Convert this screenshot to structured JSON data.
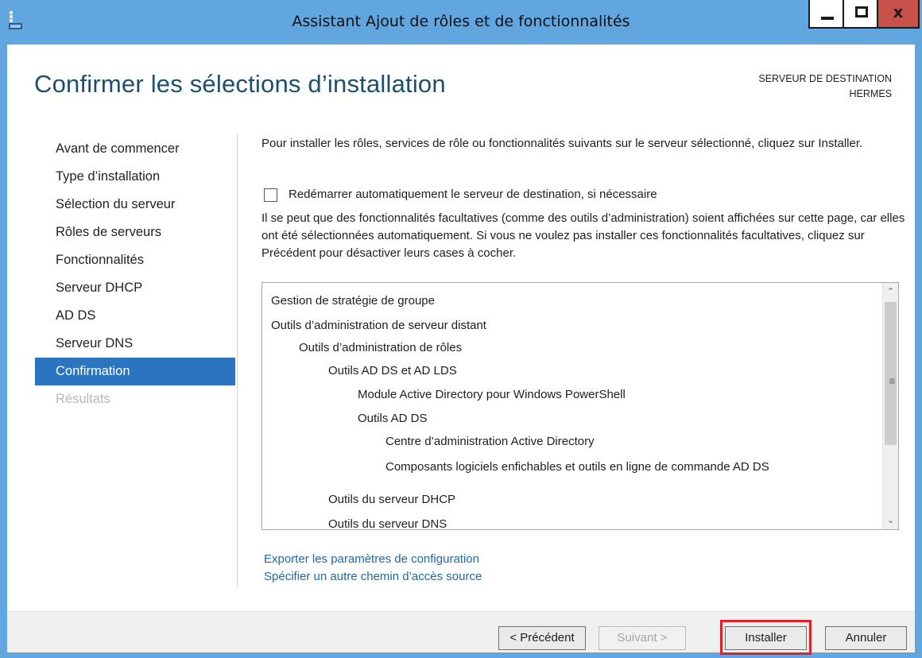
{
  "window": {
    "title": "Assistant Ajout de rôles et de fonctionnalités",
    "minimize_icon": "minimize-icon",
    "maximize_icon": "maximize-icon",
    "close_glyph": "x",
    "accent_color": "#62a6e0"
  },
  "header": {
    "page_title": "Confirmer les sélections d’installation",
    "dest_label": "SERVEUR DE DESTINATION",
    "dest_server": "HERMES"
  },
  "sidebar": {
    "items": [
      {
        "label": "Avant de commencer",
        "state": "normal"
      },
      {
        "label": "Type d’installation",
        "state": "normal"
      },
      {
        "label": "Sélection du serveur",
        "state": "normal"
      },
      {
        "label": "Rôles de serveurs",
        "state": "normal"
      },
      {
        "label": "Fonctionnalités",
        "state": "normal"
      },
      {
        "label": "Serveur DHCP",
        "state": "normal"
      },
      {
        "label": "AD DS",
        "state": "normal"
      },
      {
        "label": "Serveur DNS",
        "state": "normal"
      },
      {
        "label": "Confirmation",
        "state": "active"
      },
      {
        "label": "Résultats",
        "state": "disabled"
      }
    ],
    "active_color": "#2b74bf"
  },
  "main": {
    "intro": "Pour installer les rôles, services de rôle ou fonctionnalités suivants sur le serveur sélectionné, cliquez sur Installer.",
    "restart_checkbox": {
      "label": "Redémarrer automatiquement le serveur de destination, si nécessaire",
      "checked": false
    },
    "note": "Il se peut que des fonctionnalités facultatives (comme des outils d’administration) soient affichées sur cette page, car elles ont été sélectionnées automatiquement. Si vous ne voulez pas installer ces fonctionnalités facultatives, cliquez sur Précédent pour désactiver leurs cases à cocher.",
    "features": [
      {
        "label": "Gestion de stratégie de groupe",
        "level": 0
      },
      {
        "label": "Outils d’administration de serveur distant",
        "level": 0
      },
      {
        "label": "Outils d’administration de rôles",
        "level": 1
      },
      {
        "label": "Outils AD DS et AD LDS",
        "level": 2
      },
      {
        "label": "Module Active Directory pour Windows PowerShell",
        "level": 3
      },
      {
        "label": "Outils AD DS",
        "level": 3
      },
      {
        "label": "Centre d’administration Active Directory",
        "level": 4
      },
      {
        "label": "Composants logiciels enfichables et outils en ligne de commande AD DS",
        "level": 4
      },
      {
        "label": "Outils du serveur DHCP",
        "level": 2
      },
      {
        "label": "Outils du serveur DNS",
        "level": 2
      }
    ],
    "links": {
      "export": "Exporter les paramètres de configuration",
      "source": "Spécifier un autre chemin d’accès source"
    }
  },
  "footer": {
    "prev": "< Précédent",
    "next": "Suivant >",
    "install": "Installer",
    "cancel": "Annuler",
    "highlight_color": "#e01f26"
  }
}
